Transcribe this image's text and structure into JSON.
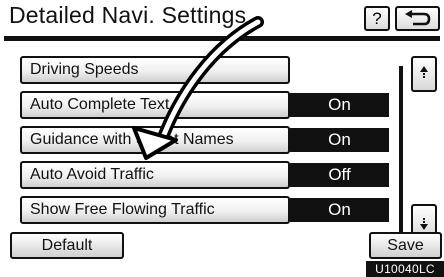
{
  "header": {
    "title": "Detailed Navi. Settings",
    "help_label": "?",
    "back_icon": "back-arrow-icon"
  },
  "rows": [
    {
      "label": "Driving Speeds",
      "status": ""
    },
    {
      "label": "Auto Complete Text",
      "status": "On"
    },
    {
      "label": "Guidance with Street Names",
      "status": "On"
    },
    {
      "label": "Auto Avoid Traffic",
      "status": "Off"
    },
    {
      "label": "Show Free Flowing Traffic",
      "status": "On"
    }
  ],
  "scroll": {
    "up_icon": "scroll-up-icon",
    "down_icon": "scroll-down-icon"
  },
  "footer": {
    "default_label": "Default",
    "save_label": "Save"
  },
  "figure_code": "U10040LC",
  "colors": {
    "status_bg": "#111111",
    "status_text": "#ffffff",
    "button_bg": "#f0f0f0"
  }
}
